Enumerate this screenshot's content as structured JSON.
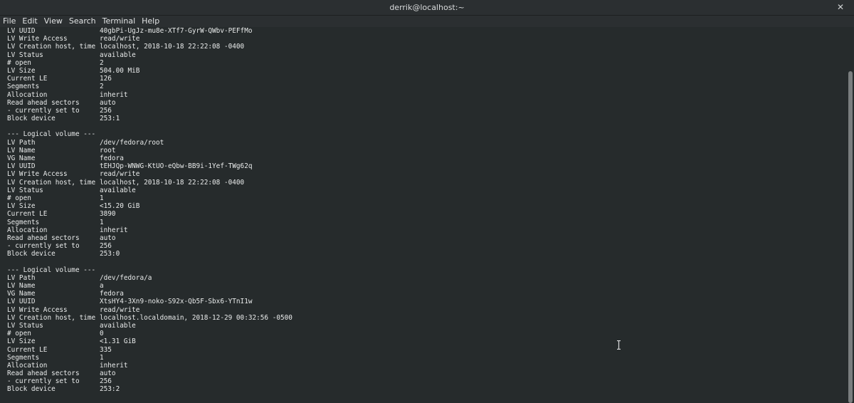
{
  "window": {
    "title": "derrik@localhost:~",
    "close_glyph": "✕"
  },
  "menubar": {
    "items": [
      "File",
      "Edit",
      "View",
      "Search",
      "Terminal",
      "Help"
    ]
  },
  "terminal": {
    "lines": [
      {
        "k": "LV UUID",
        "v": "40gbPi-UgJz-mu8e-XTf7-GyrW-QWbv-PEFfMo"
      },
      {
        "k": "LV Write Access",
        "v": "read/write"
      },
      {
        "k": "LV Creation host, time",
        "v": "localhost, 2018-10-18 22:22:08 -0400"
      },
      {
        "k": "LV Status",
        "v": "available"
      },
      {
        "k": "# open",
        "v": "2"
      },
      {
        "k": "LV Size",
        "v": "504.00 MiB"
      },
      {
        "k": "Current LE",
        "v": "126"
      },
      {
        "k": "Segments",
        "v": "2"
      },
      {
        "k": "Allocation",
        "v": "inherit"
      },
      {
        "k": "Read ahead sectors",
        "v": "auto"
      },
      {
        "k": "- currently set to",
        "v": "256"
      },
      {
        "k": "Block device",
        "v": "253:1"
      },
      {
        "k": "",
        "v": ""
      },
      {
        "k": "--- Logical volume ---",
        "v": ""
      },
      {
        "k": "LV Path",
        "v": "/dev/fedora/root"
      },
      {
        "k": "LV Name",
        "v": "root"
      },
      {
        "k": "VG Name",
        "v": "fedora"
      },
      {
        "k": "LV UUID",
        "v": "tEHJQp-WNWG-KtUO-eQbw-BB9i-1Yef-TWg62q"
      },
      {
        "k": "LV Write Access",
        "v": "read/write"
      },
      {
        "k": "LV Creation host, time",
        "v": "localhost, 2018-10-18 22:22:08 -0400"
      },
      {
        "k": "LV Status",
        "v": "available"
      },
      {
        "k": "# open",
        "v": "1"
      },
      {
        "k": "LV Size",
        "v": "<15.20 GiB"
      },
      {
        "k": "Current LE",
        "v": "3890"
      },
      {
        "k": "Segments",
        "v": "1"
      },
      {
        "k": "Allocation",
        "v": "inherit"
      },
      {
        "k": "Read ahead sectors",
        "v": "auto"
      },
      {
        "k": "- currently set to",
        "v": "256"
      },
      {
        "k": "Block device",
        "v": "253:0"
      },
      {
        "k": "",
        "v": ""
      },
      {
        "k": "--- Logical volume ---",
        "v": ""
      },
      {
        "k": "LV Path",
        "v": "/dev/fedora/a"
      },
      {
        "k": "LV Name",
        "v": "a"
      },
      {
        "k": "VG Name",
        "v": "fedora"
      },
      {
        "k": "LV UUID",
        "v": "XtsHY4-3Xn9-noko-S92x-Qb5F-Sbx6-YTnI1w"
      },
      {
        "k": "LV Write Access",
        "v": "read/write"
      },
      {
        "k": "LV Creation host, time",
        "v": "localhost.localdomain, 2018-12-29 00:32:56 -0500"
      },
      {
        "k": "LV Status",
        "v": "available"
      },
      {
        "k": "# open",
        "v": "0"
      },
      {
        "k": "LV Size",
        "v": "<1.31 GiB"
      },
      {
        "k": "Current LE",
        "v": "335"
      },
      {
        "k": "Segments",
        "v": "1"
      },
      {
        "k": "Allocation",
        "v": "inherit"
      },
      {
        "k": "Read ahead sectors",
        "v": "auto"
      },
      {
        "k": "- currently set to",
        "v": "256"
      },
      {
        "k": "Block device",
        "v": "253:2"
      }
    ]
  }
}
